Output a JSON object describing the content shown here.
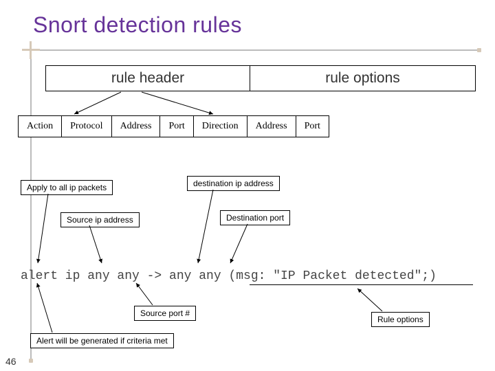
{
  "title": "Snort detection rules",
  "header": {
    "left": "rule header",
    "right": "rule options"
  },
  "fields": [
    "Action",
    "Protocol",
    "Address",
    "Port",
    "Direction",
    "Address",
    "Port"
  ],
  "labels": {
    "apply": "Apply to all ip packets",
    "dest_ip": "destination ip address",
    "src_ip": "Source ip address",
    "dest_port": "Destination port",
    "src_port": "Source port #",
    "rule_opts": "Rule options",
    "alert": "Alert will be generated if criteria met"
  },
  "rule_code": "alert ip any any -> any any (msg: \"IP Packet detected\";)",
  "slide_number": "46"
}
